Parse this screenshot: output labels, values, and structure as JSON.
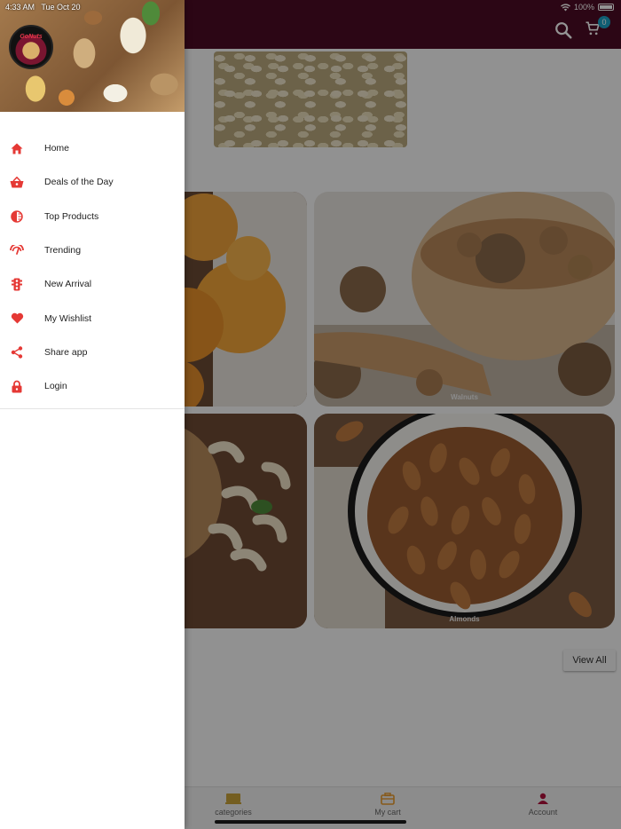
{
  "status": {
    "time": "4:33 AM",
    "date": "Tue Oct 20",
    "battery": "100%"
  },
  "header": {
    "cart_count": "0"
  },
  "categories": [
    {
      "label": ""
    },
    {
      "label": "Walnuts"
    },
    {
      "label": ""
    },
    {
      "label": "Almonds"
    }
  ],
  "view_all_label": "View All",
  "drawer": {
    "logo_text": "GoNuts",
    "items": [
      {
        "label": "Home",
        "icon": "home-icon"
      },
      {
        "label": "Deals of the Day",
        "icon": "basket-icon"
      },
      {
        "label": "Top Products",
        "icon": "top-products-icon"
      },
      {
        "label": "Trending",
        "icon": "trending-icon"
      },
      {
        "label": "New Arrival",
        "icon": "traffic-light-icon"
      },
      {
        "label": "My Wishlist",
        "icon": "heart-icon"
      },
      {
        "label": "Share app",
        "icon": "share-icon"
      },
      {
        "label": "Login",
        "icon": "lock-icon"
      }
    ]
  },
  "bottom_nav": [
    {
      "label": "categories",
      "icon": "categories-icon"
    },
    {
      "label": "My cart",
      "icon": "briefcase-icon"
    },
    {
      "label": "Account",
      "icon": "person-icon"
    }
  ],
  "colors": {
    "appbar": "#4d0c25",
    "accent": "#e53935",
    "badge": "#1aa3c7"
  }
}
